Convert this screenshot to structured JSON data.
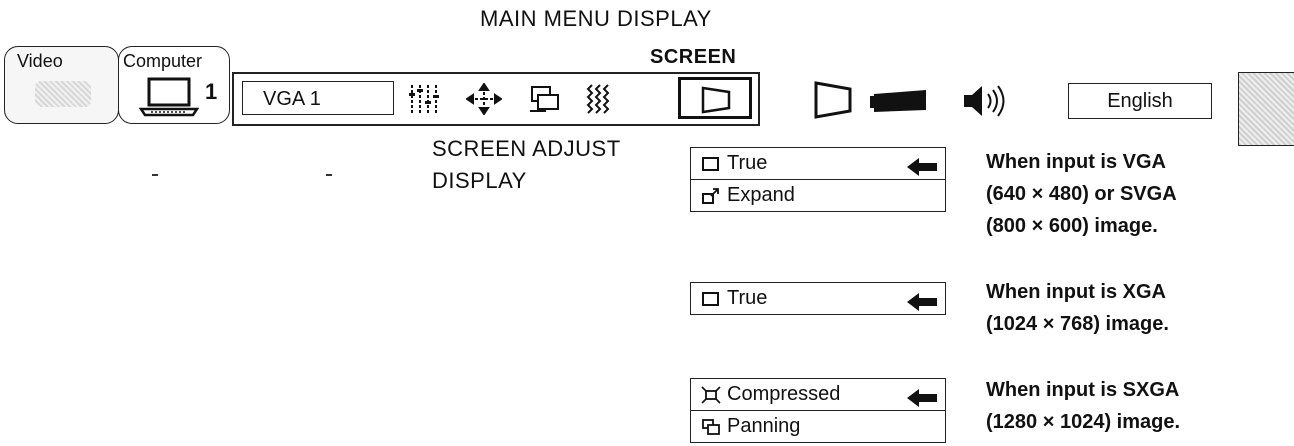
{
  "header": {
    "title": "MAIN MENU DISPLAY",
    "screen_label": "SCREEN"
  },
  "sources": [
    {
      "label": "Video"
    },
    {
      "label": "Computer",
      "number": "1"
    }
  ],
  "menubar": {
    "mode_value": "VGA 1",
    "icons": [
      "image-adjust-icon",
      "position-icon",
      "pc-adjust-icon",
      "sound-wave-icon",
      "screen-icon"
    ]
  },
  "secondary": {
    "icons": [
      "keystone-icon",
      "projector-icon",
      "speaker-icon"
    ],
    "language": "English"
  },
  "screen_adjust": {
    "label_line1": "SCREEN ADJUST",
    "label_line2": "DISPLAY"
  },
  "groups": [
    {
      "options": [
        {
          "label": "True",
          "icon": "true-icon",
          "selected": true
        },
        {
          "label": "Expand",
          "icon": "expand-icon",
          "selected": false
        }
      ],
      "note": [
        "When input  is VGA",
        "(640 × 480) or SVGA",
        "(800 × 600) image."
      ]
    },
    {
      "options": [
        {
          "label": "True",
          "icon": "true-icon",
          "selected": true
        }
      ],
      "note": [
        "When input  is XGA",
        "(1024 × 768) image."
      ]
    },
    {
      "options": [
        {
          "label": "Compressed",
          "icon": "compressed-icon",
          "selected": true
        },
        {
          "label": "Panning",
          "icon": "panning-icon",
          "selected": false
        }
      ],
      "note": [
        "When input  is SXGA",
        "(1280 × 1024) image."
      ]
    }
  ]
}
